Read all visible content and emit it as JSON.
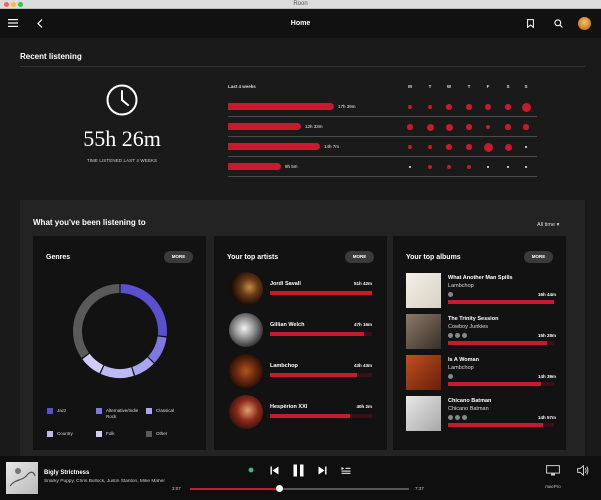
{
  "window": {
    "title": "Roon"
  },
  "header": {
    "title": "Home"
  },
  "recent": {
    "heading": "Recent listening",
    "total_time": "55h 26m",
    "caption": "TIME LISTENED LAST 4 WEEKS",
    "weeks_header": "Last 4 weeks",
    "days": [
      "M",
      "T",
      "W",
      "T",
      "F",
      "S",
      "S"
    ],
    "weeks": [
      {
        "label": "17h 39m",
        "fraction": 0.32,
        "dots": [
          1,
          1,
          2,
          2,
          2,
          2,
          4
        ]
      },
      {
        "label": "12h 33m",
        "fraction": 0.22,
        "dots": [
          2,
          3,
          3,
          2,
          1,
          2,
          2
        ]
      },
      {
        "label": "14h 7m",
        "fraction": 0.28,
        "dots": [
          1,
          1,
          2,
          2,
          4,
          3,
          0
        ]
      },
      {
        "label": "9h 5m",
        "fraction": 0.16,
        "dots": [
          0,
          1,
          1,
          1,
          0,
          0,
          0
        ]
      }
    ]
  },
  "listening": {
    "heading": "What you've been listening to",
    "range": "All time",
    "genres": {
      "title": "Genres",
      "more": "MORE",
      "legend": [
        {
          "label": "Jazz",
          "color": "#5a4fcf"
        },
        {
          "label": "Alternative/Indie Rock",
          "color": "#7e78e0"
        },
        {
          "label": "Classical",
          "color": "#aaa6ef"
        },
        {
          "label": "Country",
          "color": "#bdbaf3"
        },
        {
          "label": "Folk",
          "color": "#cfcdf8"
        },
        {
          "label": "Other",
          "color": "#5a5a5a"
        }
      ],
      "shares": [
        0.27,
        0.1,
        0.08,
        0.12,
        0.08,
        0.35
      ]
    },
    "artists": {
      "title": "Your top artists",
      "more": "MORE",
      "items": [
        {
          "name": "Jordi Savall",
          "time": "51h 42m",
          "fraction": 1.0
        },
        {
          "name": "Gillian Welch",
          "time": "47h 16m",
          "fraction": 0.92
        },
        {
          "name": "Lambchop",
          "time": "43h 43m",
          "fraction": 0.85
        },
        {
          "name": "Hespèrion XXI",
          "time": "40h 2m",
          "fraction": 0.78
        }
      ]
    },
    "albums": {
      "title": "Your top albums",
      "more": "MORE",
      "items": [
        {
          "title": "What Another Man Spills",
          "artist": "Lambchop",
          "time": "16h 44m",
          "fraction": 1.0,
          "badges": 1
        },
        {
          "title": "The Trinity Session",
          "artist": "Cowboy Junkies",
          "time": "15h 28m",
          "fraction": 0.93,
          "badges": 3
        },
        {
          "title": "Is A Woman",
          "artist": "Lambchop",
          "time": "14h 39m",
          "fraction": 0.88,
          "badges": 1
        },
        {
          "title": "Chicano Batman",
          "artist": "Chicano Batman",
          "time": "14h 57m",
          "fraction": 0.9,
          "badges": 3
        }
      ]
    }
  },
  "player": {
    "title": "Bigly Strictness",
    "artists": "Snarky Puppy, Chris Bullock, Justin Stanton, Mike Maher",
    "elapsed": "3:07",
    "total": "7:37",
    "progress": 0.41,
    "zone": "macPro"
  }
}
